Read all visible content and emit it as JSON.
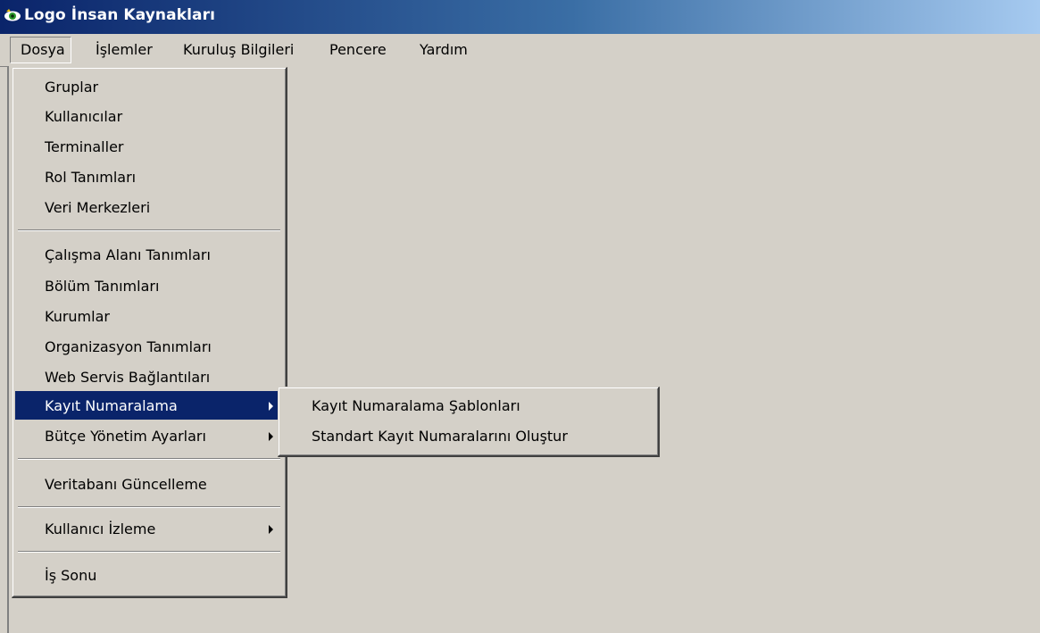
{
  "window": {
    "title": "Logo İnsan Kaynakları",
    "icon": "logo-eye-icon"
  },
  "menubar": {
    "items": [
      "Dosya",
      "İşlemler",
      "Kuruluş Bilgileri",
      "Pencere",
      "Yardım"
    ],
    "active": "Dosya"
  },
  "dosya_menu": {
    "groups": [
      [
        "Gruplar",
        "Kullanıcılar",
        "Terminaller",
        "Rol Tanımları",
        "Veri Merkezleri"
      ],
      [
        "Çalışma Alanı Tanımları",
        "Bölüm Tanımları",
        "Kurumlar",
        "Organizasyon Tanımları",
        "Web Servis Bağlantıları",
        "Kayıt Numaralama",
        "Bütçe Yönetim Ayarları"
      ],
      [
        "Veritabanı Güncelleme"
      ],
      [
        "Kullanıcı İzleme"
      ],
      [
        "İş Sonu"
      ]
    ],
    "highlighted": "Kayıt Numaralama",
    "submenu_items": [
      "Kayıt Numaralama",
      "Bütçe Yönetim Ayarları",
      "Kullanıcı İzleme"
    ]
  },
  "kayit_numaralama_submenu": {
    "items": [
      "Kayıt Numaralama Şablonları",
      "Standart Kayıt Numaralarını Oluştur"
    ]
  },
  "colors": {
    "title_gradient_start": "#0a246a",
    "title_gradient_end": "#a6caf0",
    "highlight": "#0a246a",
    "face": "#d4d0c8"
  }
}
